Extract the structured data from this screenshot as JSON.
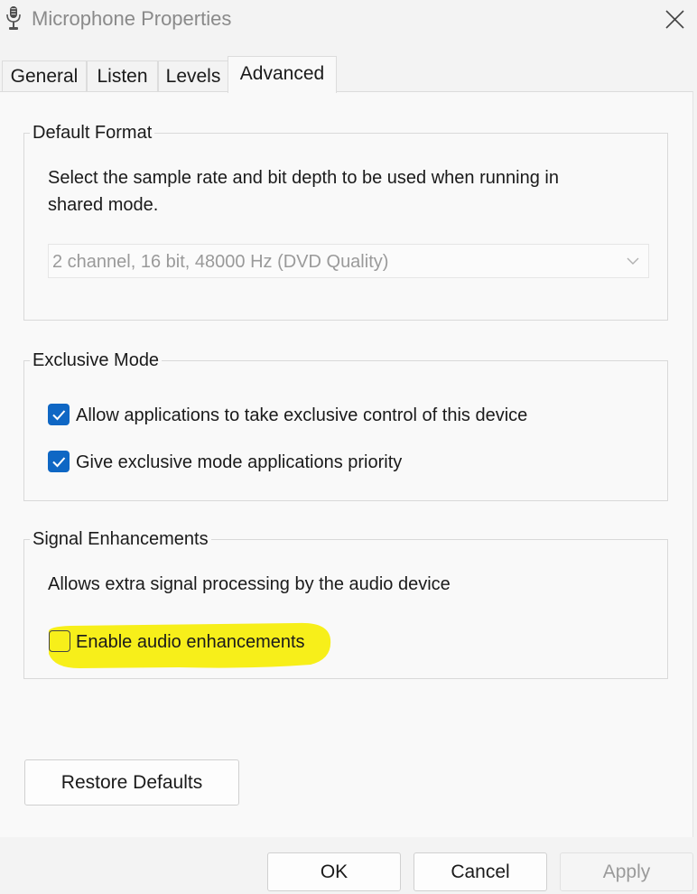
{
  "window": {
    "title": "Microphone Properties",
    "icon": "microphone-icon",
    "close_icon": "close-icon"
  },
  "tabs": [
    {
      "label": "General",
      "active": false
    },
    {
      "label": "Listen",
      "active": false
    },
    {
      "label": "Levels",
      "active": false
    },
    {
      "label": "Advanced",
      "active": true
    }
  ],
  "default_format": {
    "legend": "Default Format",
    "description_line1": "Select the sample rate and bit depth to be used when running in",
    "description_line2": "shared mode.",
    "dropdown_value": "2 channel, 16 bit, 48000 Hz (DVD Quality)",
    "dropdown_disabled": true
  },
  "exclusive_mode": {
    "legend": "Exclusive Mode",
    "options": [
      {
        "label": "Allow applications to take exclusive control of this device",
        "checked": true
      },
      {
        "label": "Give exclusive mode applications priority",
        "checked": true
      }
    ]
  },
  "signal_enhancements": {
    "legend": "Signal Enhancements",
    "description": "Allows extra signal processing by the audio device",
    "option": {
      "label": "Enable audio enhancements",
      "checked": false,
      "highlighted": true
    }
  },
  "buttons": {
    "restore_defaults": "Restore Defaults",
    "ok": "OK",
    "cancel": "Cancel",
    "apply": "Apply",
    "apply_disabled": true
  },
  "colors": {
    "accent": "#0f67c4",
    "highlight": "#f7ef1a",
    "window_bg": "#f3f3f3",
    "panel_bg": "#f9f9f9"
  }
}
